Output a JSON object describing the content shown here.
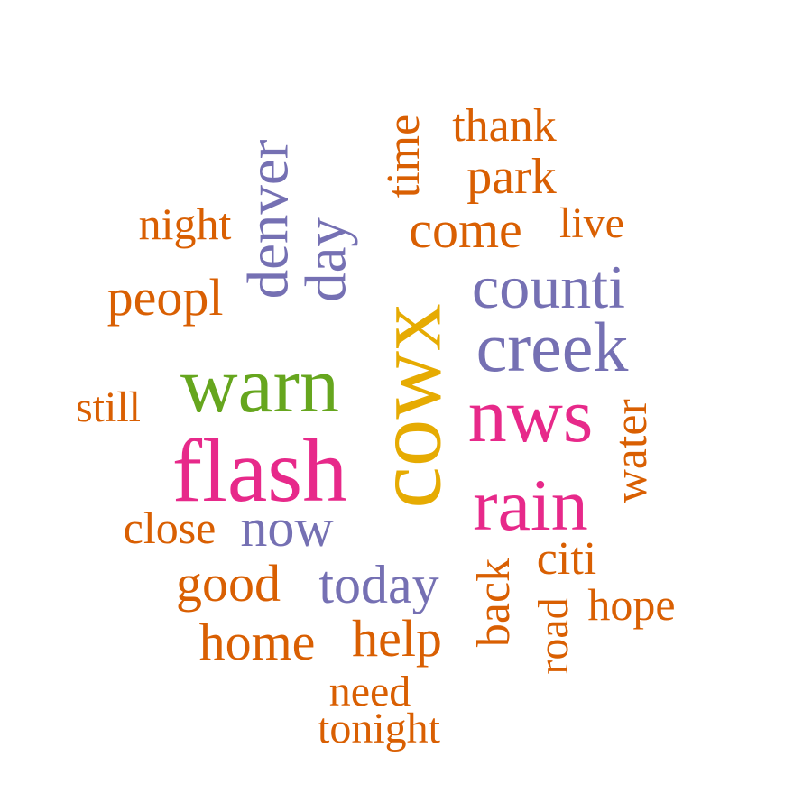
{
  "word_cloud": {
    "colors": {
      "orange": "#D95F02",
      "purple": "#7570B3",
      "pink": "#E7298A",
      "green": "#66A61E",
      "gold": "#E6AB02"
    },
    "words": [
      {
        "text": "cowx",
        "color": "#E6AB02",
        "orientation": "vertical"
      },
      {
        "text": "flash",
        "color": "#E7298A",
        "orientation": "horizontal"
      },
      {
        "text": "warn",
        "color": "#66A61E",
        "orientation": "horizontal"
      },
      {
        "text": "nws",
        "color": "#E7298A",
        "orientation": "horizontal"
      },
      {
        "text": "rain",
        "color": "#E7298A",
        "orientation": "horizontal"
      },
      {
        "text": "creek",
        "color": "#7570B3",
        "orientation": "horizontal"
      },
      {
        "text": "counti",
        "color": "#7570B3",
        "orientation": "horizontal"
      },
      {
        "text": "denver",
        "color": "#7570B3",
        "orientation": "vertical"
      },
      {
        "text": "day",
        "color": "#7570B3",
        "orientation": "vertical"
      },
      {
        "text": "now",
        "color": "#7570B3",
        "orientation": "horizontal"
      },
      {
        "text": "today",
        "color": "#7570B3",
        "orientation": "horizontal"
      },
      {
        "text": "peopl",
        "color": "#D95F02",
        "orientation": "horizontal"
      },
      {
        "text": "come",
        "color": "#D95F02",
        "orientation": "horizontal"
      },
      {
        "text": "water",
        "color": "#D95F02",
        "orientation": "vertical"
      },
      {
        "text": "back",
        "color": "#D95F02",
        "orientation": "vertical"
      },
      {
        "text": "citi",
        "color": "#D95F02",
        "orientation": "horizontal"
      },
      {
        "text": "good",
        "color": "#D95F02",
        "orientation": "horizontal"
      },
      {
        "text": "help",
        "color": "#D95F02",
        "orientation": "horizontal"
      },
      {
        "text": "home",
        "color": "#D95F02",
        "orientation": "horizontal"
      },
      {
        "text": "park",
        "color": "#D95F02",
        "orientation": "horizontal"
      },
      {
        "text": "time",
        "color": "#D95F02",
        "orientation": "vertical"
      },
      {
        "text": "close",
        "color": "#D95F02",
        "orientation": "horizontal"
      },
      {
        "text": "night",
        "color": "#D95F02",
        "orientation": "horizontal"
      },
      {
        "text": "still",
        "color": "#D95F02",
        "orientation": "horizontal"
      },
      {
        "text": "live",
        "color": "#D95F02",
        "orientation": "horizontal"
      },
      {
        "text": "thank",
        "color": "#D95F02",
        "orientation": "horizontal"
      },
      {
        "text": "hope",
        "color": "#D95F02",
        "orientation": "horizontal"
      },
      {
        "text": "road",
        "color": "#D95F02",
        "orientation": "vertical"
      },
      {
        "text": "need",
        "color": "#D95F02",
        "orientation": "horizontal"
      },
      {
        "text": "tonight",
        "color": "#D95F02",
        "orientation": "horizontal"
      }
    ]
  }
}
